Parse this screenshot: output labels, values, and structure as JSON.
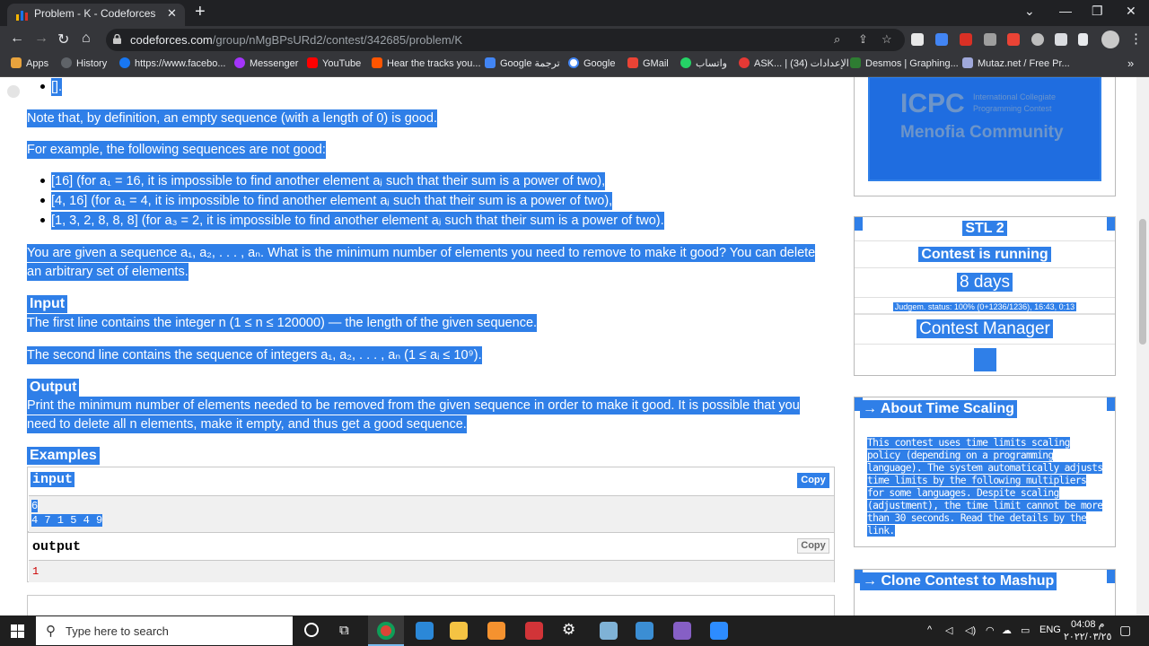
{
  "browser": {
    "tab_title": "Problem - K - Codeforces",
    "tab_close": "✕",
    "new_tab": "+",
    "url_host": "codeforces.com",
    "url_path": "/group/nMgBPsURd2/contest/342685/problem/K",
    "bookmarks": [
      "Apps",
      "History",
      "https://www.facebo...",
      "Messenger",
      "YouTube",
      "Hear the tracks you...",
      "Google ترجمة",
      "Google",
      "GMail",
      "واتساب",
      "ASK... | الإعدادات (34)",
      "Desmos | Graphing...",
      "Mutaz.net / Free Pr..."
    ],
    "bookmarks_more": "»"
  },
  "problem": {
    "empty_bullet": "[].",
    "note_empty": "Note that, by definition, an empty sequence (with a length of 0) is good.",
    "not_good_intro": "For example, the following sequences are not good:",
    "not_good_items": [
      "[16] (for a₁ = 16, it is impossible to find another element aⱼ such that their sum is a power of two),",
      "[4, 16] (for a₁ = 4, it is impossible to find another element aⱼ such that their sum is a power of two),",
      "[1, 3, 2, 8, 8, 8] (for a₃ = 2, it is impossible to find another element aⱼ such that their sum is a power of two)."
    ],
    "statement_line1": "You are given a sequence a₁, a₂, . . . , aₙ. What is the minimum number of elements you need to remove to make it good? You can delete",
    "statement_line2": "an arbitrary set of elements.",
    "input_heading": "Input",
    "input_line1": "The first line contains the integer n (1 ≤ n ≤ 120000) — the length of the given sequence.",
    "input_line2": "The second line contains the sequence of integers a₁, a₂, . . . , aₙ (1 ≤ aᵢ ≤ 10⁹).",
    "output_heading": "Output",
    "output_line1": "Print the minimum number of elements needed to be removed from the given sequence in order to make it good. It is possible that you",
    "output_line2": "need to delete all n elements, make it empty, and thus get a good sequence.",
    "examples_heading": "Examples",
    "input_label": "input",
    "output_label": "output",
    "copy_label": "Copy",
    "input_data_line1": "6",
    "input_data_line2": "4 7 1 5 4 9",
    "output_data": "1"
  },
  "sidebar": {
    "banner_line1": "ICPC",
    "banner_line2": "International Collegiate",
    "banner_line3": "Programming Contest",
    "banner_line4": "Menofia Community",
    "contest_name": "STL 2",
    "contest_status": "Contest is running",
    "time_left": "8 days",
    "judgement": "Judgem. status: 100% (0+1236/1236), 16:43, 0:13",
    "manager": "Contest Manager",
    "time_scaling_title": "→ About Time Scaling",
    "time_scaling_text": "This contest uses time limits scaling policy (depending on a programming language). The system automatically adjusts time limits by the following multipliers for some languages. Despite scaling (adjustment), the time limit cannot be more than 30 seconds. Read the details by the link.",
    "clone_title": "→ Clone Contest to Mashup"
  },
  "taskbar": {
    "search_placeholder": "Type here to search",
    "lang": "ENG",
    "time": "04:08 م",
    "date": "٢٠٢٢/٠٣/٢٥"
  },
  "colors": {
    "selection": "#2f7fe8",
    "chrome_dark": "#202124",
    "chrome_toolbar": "#35363a"
  }
}
